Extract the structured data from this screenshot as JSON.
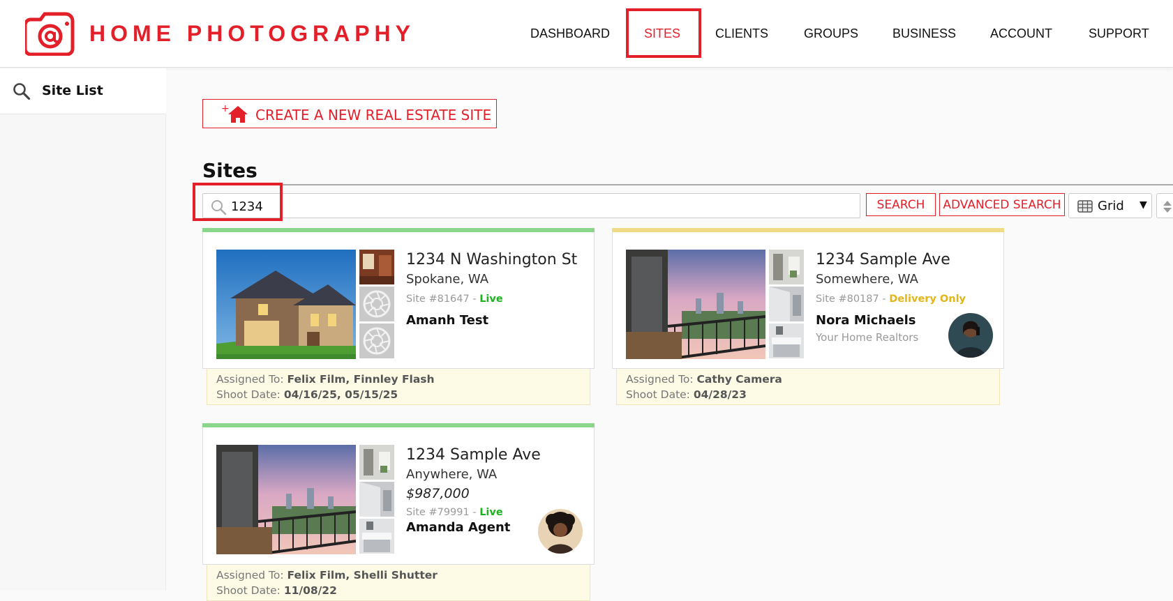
{
  "brand": {
    "name": "HOME PHOTOGRAPHY",
    "accent": "#e3202a"
  },
  "nav": {
    "dashboard": "DASHBOARD",
    "sites": "SITES",
    "clients": "CLIENTS",
    "groups": "GROUPS",
    "business": "BUSINESS",
    "account": "ACCOUNT",
    "support": "SUPPORT",
    "active": "SITES"
  },
  "sidebar": {
    "item_label": "Site List",
    "icon": "search-icon"
  },
  "toolbar": {
    "create_label": "CREATE A NEW REAL ESTATE SITE",
    "create_icon": "add-home-icon"
  },
  "sites": {
    "title": "Sites",
    "search_value": "1234",
    "search_button": "SEARCH",
    "advanced_search_button": "ADVANCED SEARCH",
    "view_mode": "Grid"
  },
  "cards": [
    {
      "address": "1234 N Washington St",
      "city": "Spokane, WA",
      "site_number": "Site #81647 - ",
      "status": "Live",
      "status_color": "#1bb31b",
      "agent": "Amanh Test",
      "assigned_label": "Assigned To: ",
      "assigned_to": "Felix Film, Finnley Flash",
      "shoot_label": "Shoot Date: ",
      "shoot_date": "04/16/25, 05/15/25",
      "bar_color": "#8ad68a"
    },
    {
      "address": "1234 Sample Ave",
      "city": "Somewhere, WA",
      "site_number": "Site #80187 - ",
      "status": "Delivery Only",
      "status_color": "#e2b61b",
      "agent": "Nora Michaels",
      "company": "Your Home Realtors",
      "assigned_label": "Assigned To: ",
      "assigned_to": "Cathy Camera",
      "shoot_label": "Shoot Date: ",
      "shoot_date": "04/28/23",
      "bar_color": "#f0dc86"
    },
    {
      "address": "1234 Sample Ave",
      "city": "Anywhere, WA",
      "price": "$987,000",
      "site_number": "Site #79991 - ",
      "status": "Live",
      "status_color": "#1bb31b",
      "agent": "Amanda Agent",
      "assigned_label": "Assigned To: ",
      "assigned_to": "Felix Film, Shelli Shutter",
      "shoot_label": "Shoot Date: ",
      "shoot_date": "11/08/22",
      "bar_color": "#8ad68a"
    }
  ]
}
